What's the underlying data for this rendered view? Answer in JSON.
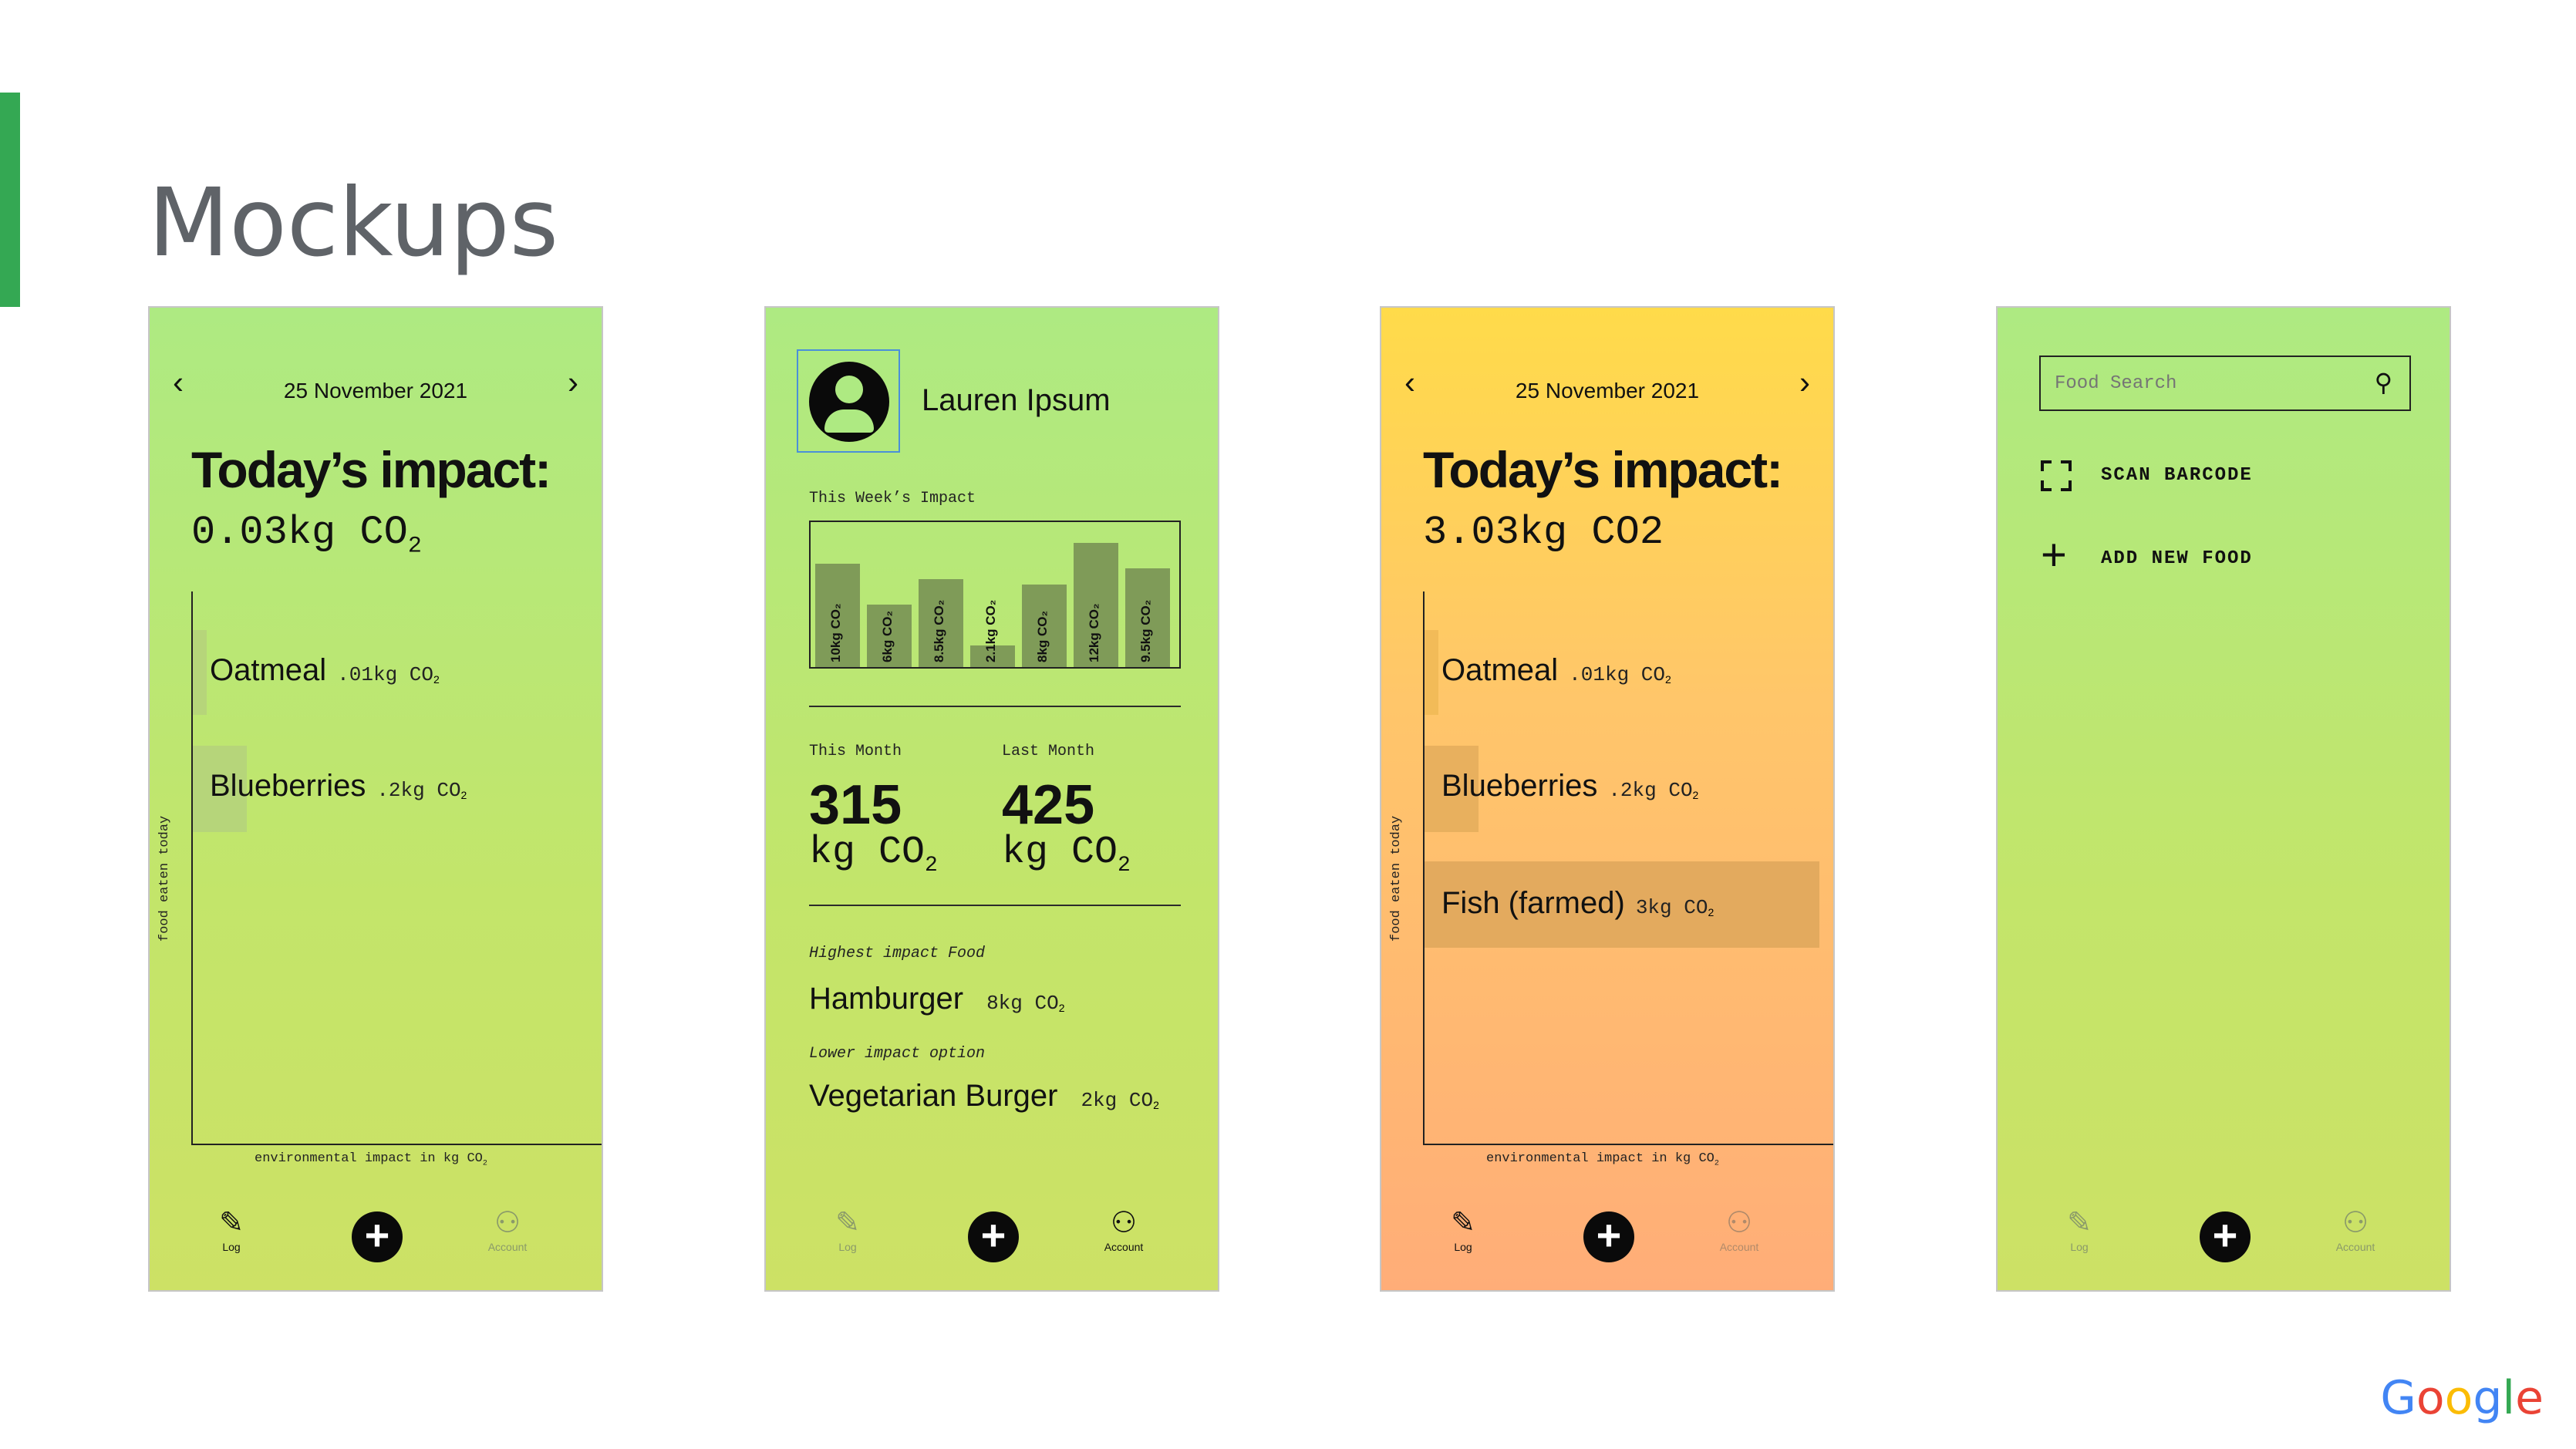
{
  "slide": {
    "title": "Mockups"
  },
  "brand": {
    "logo_text": "Google",
    "colors": [
      "#4285F4",
      "#EA4335",
      "#FBBC05",
      "#4285F4",
      "#34A853",
      "#EA4335"
    ]
  },
  "nav": {
    "log": "Log",
    "account": "Account",
    "add_icon": "plus-icon",
    "log_icon": "edit-icon",
    "account_icon": "person-icon"
  },
  "screen1": {
    "date": "25 November 2021",
    "impact_title": "Today’s impact:",
    "impact_value": "0.03kg CO",
    "impact_sub": "2",
    "items": [
      {
        "name": "Oatmeal",
        "co2": ".01kg CO",
        "sub": "2"
      },
      {
        "name": "Blueberries",
        "co2": ".2kg CO",
        "sub": "2"
      }
    ],
    "x_axis_label": "environmental impact in kg CO",
    "x_axis_sub": "2",
    "y_axis_label": "food eaten today"
  },
  "screen2": {
    "user_name": "Lauren Ipsum",
    "week_title": "This Week’s Impact",
    "week_bars": [
      {
        "label": "10kg CO₂",
        "value": 10
      },
      {
        "label": "6kg CO₂",
        "value": 6
      },
      {
        "label": "8.5kg CO₂",
        "value": 8.5
      },
      {
        "label": "2.1kg CO₂",
        "value": 2.1
      },
      {
        "label": "8kg CO₂",
        "value": 8
      },
      {
        "label": "12kg CO₂",
        "value": 12
      },
      {
        "label": "9.5kg CO₂",
        "value": 9.5
      }
    ],
    "this_month_label": "This Month",
    "this_month_value": "315",
    "last_month_label": "Last Month",
    "last_month_value": "425",
    "unit": "kg CO",
    "unit_sub": "2",
    "highest_label": "Highest impact Food",
    "highest_name": "Hamburger",
    "highest_co2": "8kg CO",
    "lower_label": "Lower impact option",
    "lower_name": "Vegetarian Burger",
    "lower_co2": "2kg CO",
    "co2_sub": "2"
  },
  "screen3": {
    "date": "25 November 2021",
    "impact_title": "Today’s impact:",
    "impact_value": "3.03kg CO2",
    "items": [
      {
        "name": "Oatmeal",
        "co2": ".01kg CO",
        "sub": "2"
      },
      {
        "name": "Blueberries",
        "co2": ".2kg CO",
        "sub": "2"
      },
      {
        "name": "Fish (farmed)",
        "co2": "3kg CO",
        "sub": "2"
      }
    ],
    "x_axis_label": "environmental impact in kg CO",
    "x_axis_sub": "2",
    "y_axis_label": "food eaten today"
  },
  "screen4": {
    "search_placeholder": "Food Search",
    "scan_barcode": "SCAN BARCODE",
    "add_new_food": "ADD NEW FOOD"
  }
}
